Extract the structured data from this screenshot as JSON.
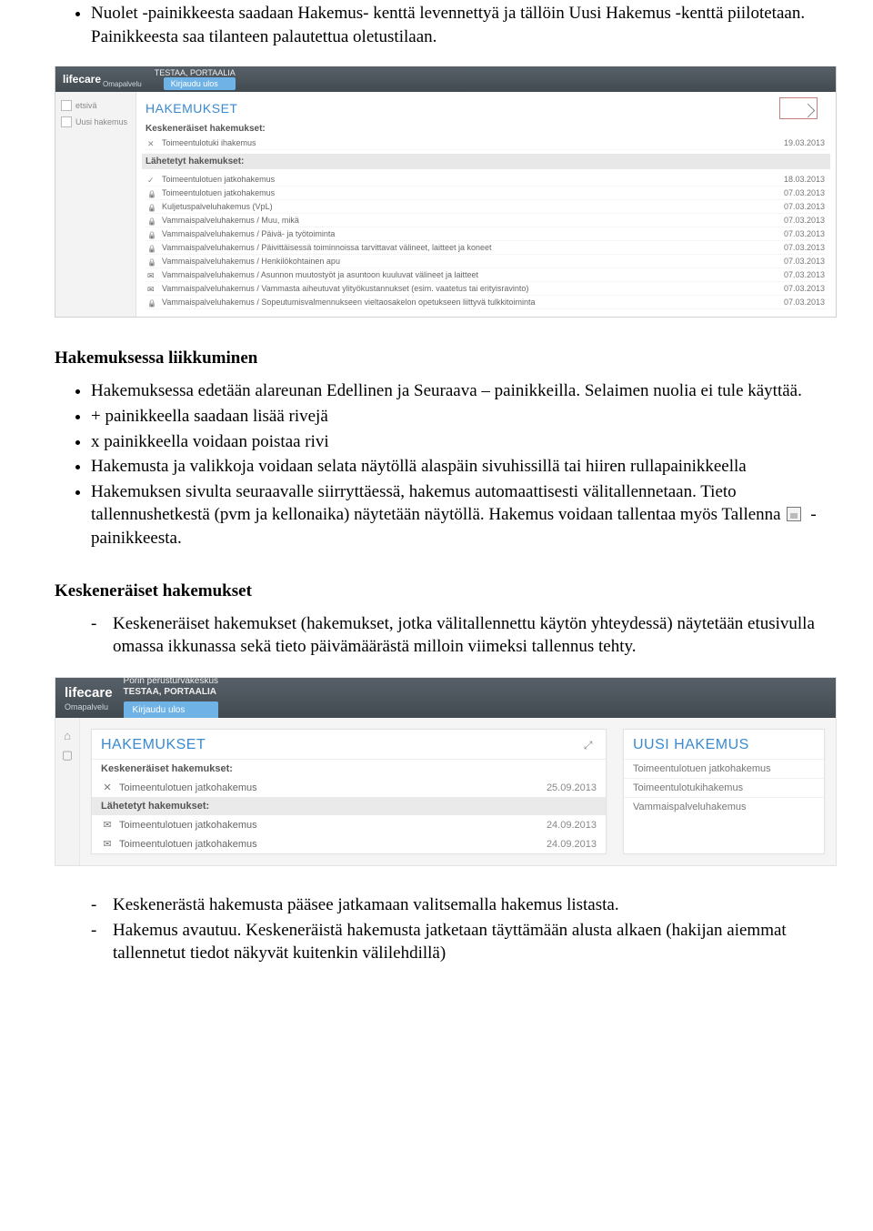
{
  "intro_bullets": [
    "Nuolet -painikkeesta saadaan Hakemus- kenttä levennettyä ja tällöin Uusi Hakemus -kenttä piilotetaan. Painikkeesta saa tilanteen palautettua oletustilaan."
  ],
  "shot1": {
    "brand": "lifecare",
    "brand_sub": "Omapalvelu",
    "user_label": "TESTAA, PORTAALIA",
    "logout_label": "Kirjaudu ulos",
    "sidebar": {
      "items": [
        {
          "label": "etsivä"
        },
        {
          "label": "Uusi hakemus"
        }
      ]
    },
    "panel_title": "HAKEMUKSET",
    "section_unfinished": "Keskeneräiset hakemukset:",
    "section_sent": "Lähetetyt hakemukset:",
    "unfinished_rows": [
      {
        "icon": "x",
        "text": "Toimeentulotuki ihakemus",
        "date": "19.03.2013"
      }
    ],
    "sent_rows": [
      {
        "icon": "check",
        "text": "Toimeentulotuen jatkohakemus",
        "date": "18.03.2013"
      },
      {
        "icon": "lock",
        "text": "Toimeentulotuen jatkohakemus",
        "date": "07.03.2013"
      },
      {
        "icon": "lock",
        "text": "Kuljetuspalveluhakemus (VpL)",
        "date": "07.03.2013"
      },
      {
        "icon": "lock",
        "text": "Vammaispalveluhakemus / Muu, mikä",
        "date": "07.03.2013"
      },
      {
        "icon": "lock",
        "text": "Vammaispalveluhakemus / Päivä- ja työtoiminta",
        "date": "07.03.2013"
      },
      {
        "icon": "lock",
        "text": "Vammaispalveluhakemus / Päivittäisessä toiminnoissa tarvittavat välineet, laitteet ja koneet",
        "date": "07.03.2013"
      },
      {
        "icon": "lock",
        "text": "Vammaispalveluhakemus / Henkilökohtainen apu",
        "date": "07.03.2013"
      },
      {
        "icon": "env",
        "text": "Vammaispalveluhakemus / Asunnon muutostyöt ja asuntoon kuuluvat välineet ja laitteet",
        "date": "07.03.2013"
      },
      {
        "icon": "env",
        "text": "Vammaispalveluhakemus / Vammasta aiheutuvat ylityökustannukset (esim. vaatetus tai erityisravinto)",
        "date": "07.03.2013"
      },
      {
        "icon": "lock",
        "text": "Vammaispalveluhakemus / Sopeutumisvalmennukseen vieltaosakelon opetukseen liittyvä tulkkitoiminta",
        "date": "07.03.2013"
      }
    ]
  },
  "section2_title": "Hakemuksessa liikkuminen",
  "section2_bullets": [
    "Hakemuksessa edetään alareunan Edellinen ja Seuraava – painikkeilla. Selaimen nuolia ei tule käyttää.",
    "+ painikkeella saadaan lisää rivejä",
    "x painikkeella voidaan poistaa rivi",
    "Hakemusta ja valikkoja voidaan selata näytöllä alaspäin sivuhissillä tai hiiren rullapainikkeella",
    "__SAVE__"
  ],
  "save_bullet_prefix": "Hakemuksen sivulta seuraavalle siirryttäessä, hakemus automaattisesti välitallennetaan. Tieto tallennushetkestä (pvm ja kellonaika) näytetään näytöllä. Hakemus voidaan tallentaa myös Tallenna",
  "save_bullet_suffix": "- painikkeesta.",
  "section3_title": "Keskeneräiset hakemukset",
  "section3_dashes": [
    "Keskeneräiset hakemukset (hakemukset, jotka välitallennettu käytön yhteydessä) näytetään etusivulla omassa ikkunassa sekä tieto päivämäärästä milloin viimeksi tallennus tehty."
  ],
  "shot2": {
    "brand": "lifecare",
    "brand_sub": "Omapalvelu",
    "org_line1": "Porin perusturvakeskus",
    "org_line2": "TESTAA, PORTAALIA",
    "logout_label": "Kirjaudu ulos",
    "panel_title": "HAKEMUKSET",
    "section_unfinished": "Keskeneräiset hakemukset:",
    "section_sent": "Lähetetyt hakemukset:",
    "unfinished_rows": [
      {
        "icon": "✕",
        "text": "Toimeentulotuen jatkohakemus",
        "date": "25.09.2013"
      }
    ],
    "sent_rows": [
      {
        "icon": "✉",
        "text": "Toimeentulotuen jatkohakemus",
        "date": "24.09.2013"
      },
      {
        "icon": "✉",
        "text": "Toimeentulotuen jatkohakemus",
        "date": "24.09.2013"
      }
    ],
    "side_title": "UUSI HAKEMUS",
    "side_links": [
      "Toimeentulotuen jatkohakemus",
      "Toimeentulotukihakemus",
      "Vammaispalveluhakemus"
    ]
  },
  "section4_dashes": [
    "Keskenerästä hakemusta pääsee jatkamaan valitsemalla hakemus listasta.",
    "Hakemus avautuu. Keskeneräistä hakemusta jatketaan täyttämään alusta alkaen (hakijan aiemmat tallennetut tiedot näkyvät kuitenkin välilehdillä)"
  ]
}
